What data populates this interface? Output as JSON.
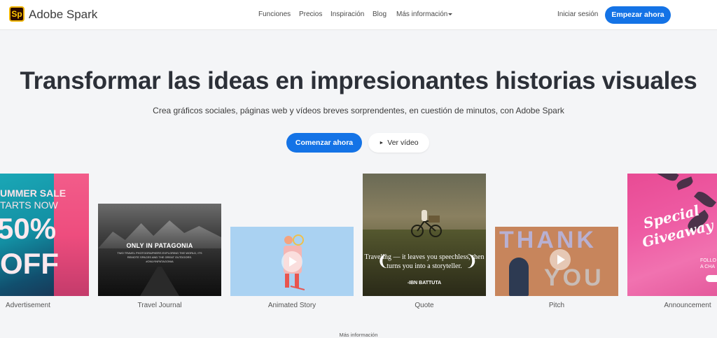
{
  "header": {
    "logo_text": "Sp",
    "brand": "Adobe Spark",
    "nav": [
      "Funciones",
      "Precios",
      "Inspiración",
      "Blog",
      "Más información"
    ],
    "signin": "Iniciar sesión",
    "cta": "Empezar ahora"
  },
  "hero": {
    "title": "Transformar las ideas en impresionantes historias visuales",
    "subtitle": "Crea gráficos sociales, páginas web y vídeos breves sorprendentes, en cuestión de minutos, con Adobe Spark",
    "primary_button": "Comenzar ahora",
    "secondary_button": "Ver vídeo"
  },
  "cards": {
    "advertisement": {
      "label": "Advertisement",
      "line1": "UMMER SALE",
      "line2": "TARTS NOW",
      "line3": "50%",
      "line4": "OFF"
    },
    "travel_journal": {
      "label": "Travel Journal",
      "title": "ONLY IN PATAGONIA",
      "body": "TWO TRAVEL PHOTOGRAPHERS EXPLORING THE WORLD, ITS REMOTE SPACES AND THE GREAT OUTDOORS. #ONLYINPATAGONIA"
    },
    "animated_story": {
      "label": "Animated Story"
    },
    "quote": {
      "label": "Quote",
      "text": "Traveling — it leaves you speechless, then turns you into a storyteller.",
      "author": "-IBN BATTUTA"
    },
    "pitch": {
      "label": "Pitch",
      "word1": "THANK",
      "word2": "YOU"
    },
    "announcement": {
      "label": "Announcement",
      "line1": "Special",
      "line2": "Giveaway",
      "small": "FOLLO\nA CHA"
    }
  },
  "footer": {
    "more_info": "Más información"
  },
  "colors": {
    "primary": "#1473e6",
    "background": "#f4f5f7",
    "logo_bg": "#2b0b00",
    "logo_accent": "#ffc800"
  }
}
